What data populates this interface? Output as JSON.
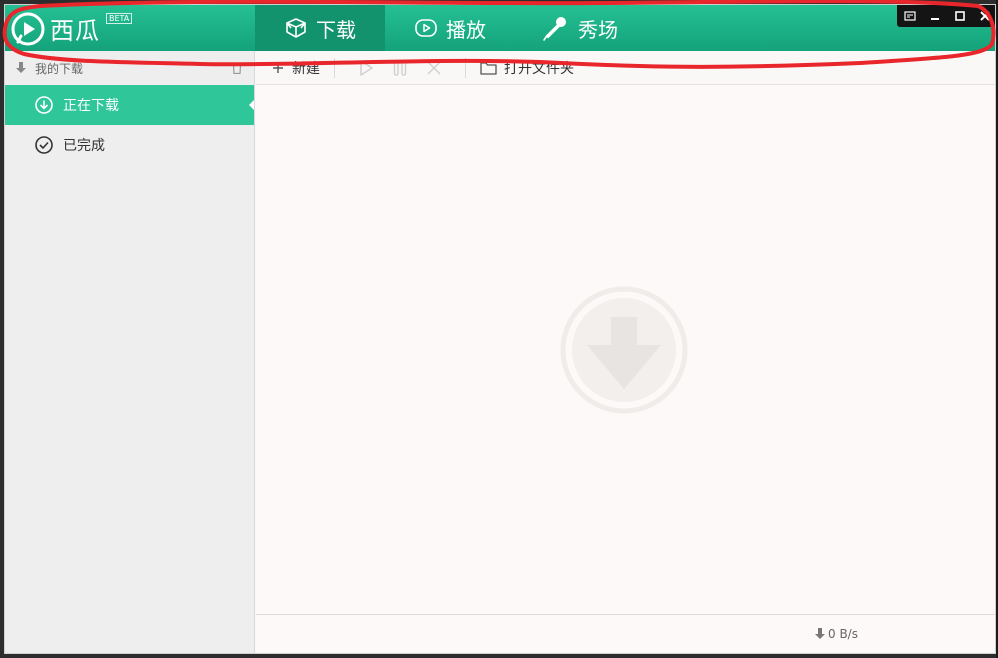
{
  "app": {
    "name": "西瓜",
    "beta": "BETA",
    "brand_color": "#1fb389",
    "active_color": "#2fc69a"
  },
  "nav": {
    "tabs": [
      {
        "label": "下载",
        "icon": "box-icon",
        "active": true
      },
      {
        "label": "播放",
        "icon": "play-circle-icon",
        "active": false
      },
      {
        "label": "秀场",
        "icon": "microphone-icon",
        "active": false
      }
    ]
  },
  "window_controls": [
    "skin-icon",
    "minimize-icon",
    "maximize-icon",
    "close-icon"
  ],
  "sidebar": {
    "header": "我的下载",
    "items": [
      {
        "label": "正在下载",
        "icon": "download-circle-icon",
        "active": true
      },
      {
        "label": "已完成",
        "icon": "check-circle-icon",
        "active": false
      }
    ]
  },
  "toolbar": {
    "new_label": "新建",
    "open_folder_label": "打开文件夹"
  },
  "status": {
    "speed": "0 B/s"
  },
  "annotation_color": "#e8262b"
}
